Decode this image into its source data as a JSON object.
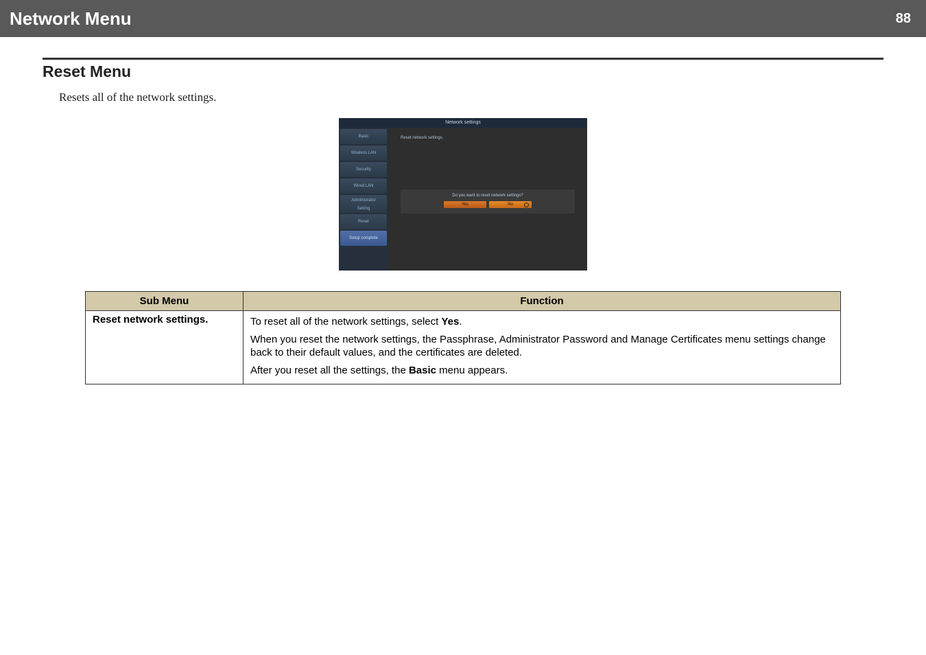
{
  "header": {
    "title": "Network Menu",
    "page_number": "88"
  },
  "section": {
    "title": "Reset Menu",
    "description": "Resets all of the network settings."
  },
  "screenshot": {
    "topbar": "Network settings",
    "tabs": {
      "basic": "Basic",
      "wireless": "Wireless LAN",
      "security": "Security",
      "wired": "Wired LAN",
      "admin_line1": "Administrator",
      "admin_line2": "Setting",
      "reset": "Reset",
      "complete": "Setup complete"
    },
    "reset_label": "Reset network settings.",
    "dialog_question": "Do you want to reset network settings?",
    "btn_yes": "Yes",
    "btn_no": "No"
  },
  "table": {
    "headers": {
      "sub_menu": "Sub Menu",
      "function": "Function"
    },
    "row": {
      "label": "Reset network settings.",
      "line1_prefix": "To reset all of the network settings, select ",
      "line1_bold": "Yes",
      "line1_suffix": ".",
      "line2": "When you reset the network settings, the Passphrase, Administrator Password and Manage Certificates menu settings change back to their default values, and the certificates are deleted.",
      "line3_prefix": "After you reset all the settings, the ",
      "line3_bold": "Basic",
      "line3_suffix": " menu appears."
    }
  }
}
